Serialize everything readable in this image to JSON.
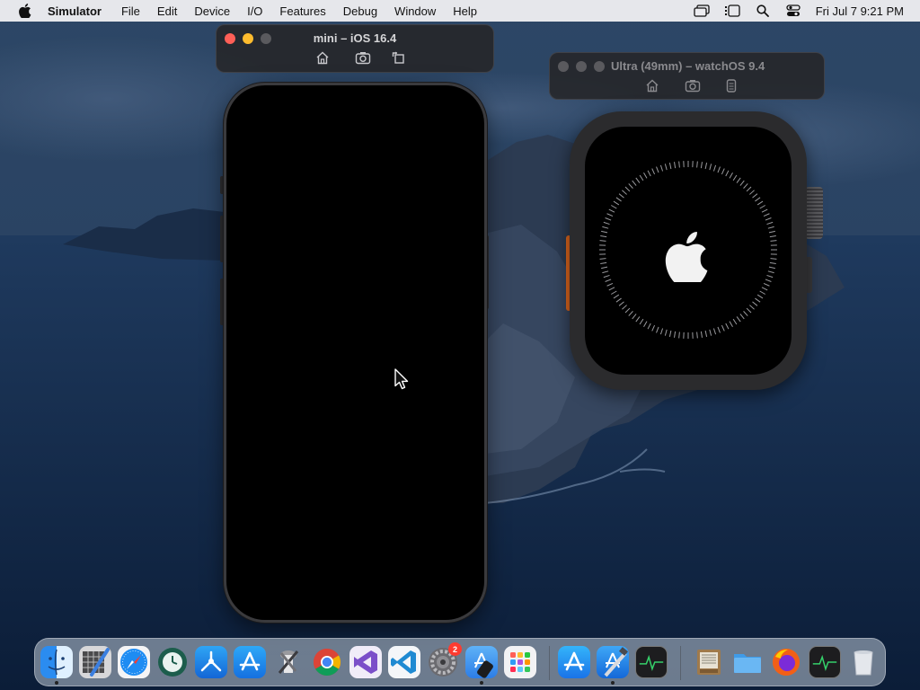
{
  "menubar": {
    "app_name": "Simulator",
    "menus": [
      "File",
      "Edit",
      "Device",
      "I/O",
      "Features",
      "Debug",
      "Window",
      "Help"
    ],
    "clock": "Fri Jul 7  9:21 PM"
  },
  "windows": {
    "iphone": {
      "title": "mini – iOS 16.4"
    },
    "watch": {
      "title": "Ultra (49mm) – watchOS 9.4"
    }
  },
  "dock": {
    "badge_count": "2",
    "apps": [
      {
        "icon": "finder-icon",
        "running": true
      },
      {
        "icon": "instruments-icon",
        "running": false
      },
      {
        "icon": "safari-icon",
        "running": false
      },
      {
        "icon": "time-machine-icon",
        "running": false
      },
      {
        "icon": "testflight-icon",
        "running": false
      },
      {
        "icon": "app-store-connect-icon",
        "running": false
      },
      {
        "icon": "xcode-utilities-icon",
        "running": false
      },
      {
        "icon": "chrome-icon",
        "running": false
      },
      {
        "icon": "visual-studio-icon",
        "running": false
      },
      {
        "icon": "vscode-icon",
        "running": false
      },
      {
        "icon": "system-preferences-icon",
        "running": false
      },
      {
        "icon": "simulator-icon",
        "running": true
      },
      {
        "icon": "launchpad-icon",
        "running": false
      },
      {
        "icon": "app-store-icon",
        "running": false
      },
      {
        "icon": "xcode-icon",
        "running": true
      },
      {
        "icon": "activity-monitor-icon",
        "running": false
      },
      {
        "icon": "archive-utility-icon",
        "running": false
      },
      {
        "icon": "folder-icon",
        "running": false
      },
      {
        "icon": "firefox-icon",
        "running": false
      },
      {
        "icon": "activity-monitor-2-icon",
        "running": false
      },
      {
        "icon": "trash-icon",
        "running": false
      }
    ]
  },
  "colors": {
    "close": "#ff5f57",
    "minimize": "#febc2e",
    "zoom_disabled": "#5a5a5e",
    "watch_orange": "#e0661d"
  }
}
